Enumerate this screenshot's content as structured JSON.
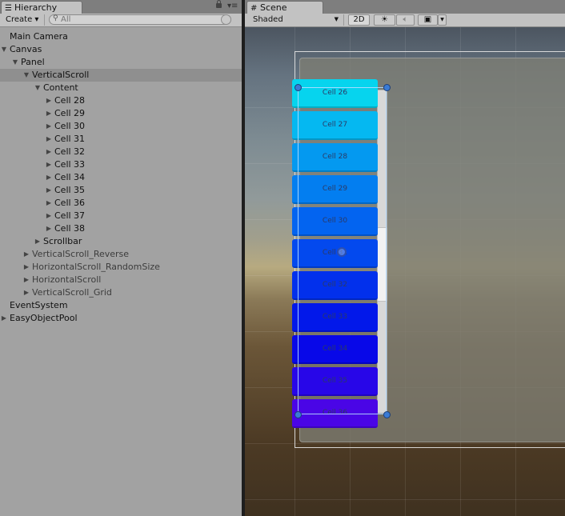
{
  "hierarchy": {
    "tab_label": "Hierarchy",
    "tab_icon": "list-icon",
    "create_label": "Create ▾",
    "search_placeholder": "All",
    "items": [
      {
        "label": "Main Camera",
        "depth": 0,
        "arrow": "",
        "selected": false,
        "dim": false
      },
      {
        "label": "Canvas",
        "depth": 0,
        "arrow": "▼",
        "selected": false,
        "dim": false
      },
      {
        "label": "Panel",
        "depth": 1,
        "arrow": "▼",
        "selected": false,
        "dim": false
      },
      {
        "label": "VerticalScroll",
        "depth": 2,
        "arrow": "▼",
        "selected": true,
        "dim": false
      },
      {
        "label": "Content",
        "depth": 3,
        "arrow": "▼",
        "selected": false,
        "dim": false
      },
      {
        "label": "Cell 28",
        "depth": 4,
        "arrow": "▶",
        "selected": false,
        "dim": false
      },
      {
        "label": "Cell 29",
        "depth": 4,
        "arrow": "▶",
        "selected": false,
        "dim": false
      },
      {
        "label": "Cell 30",
        "depth": 4,
        "arrow": "▶",
        "selected": false,
        "dim": false
      },
      {
        "label": "Cell 31",
        "depth": 4,
        "arrow": "▶",
        "selected": false,
        "dim": false
      },
      {
        "label": "Cell 32",
        "depth": 4,
        "arrow": "▶",
        "selected": false,
        "dim": false
      },
      {
        "label": "Cell 33",
        "depth": 4,
        "arrow": "▶",
        "selected": false,
        "dim": false
      },
      {
        "label": "Cell 34",
        "depth": 4,
        "arrow": "▶",
        "selected": false,
        "dim": false
      },
      {
        "label": "Cell 35",
        "depth": 4,
        "arrow": "▶",
        "selected": false,
        "dim": false
      },
      {
        "label": "Cell 36",
        "depth": 4,
        "arrow": "▶",
        "selected": false,
        "dim": false
      },
      {
        "label": "Cell 37",
        "depth": 4,
        "arrow": "▶",
        "selected": false,
        "dim": false
      },
      {
        "label": "Cell 38",
        "depth": 4,
        "arrow": "▶",
        "selected": false,
        "dim": false
      },
      {
        "label": "Scrollbar",
        "depth": 3,
        "arrow": "▶",
        "selected": false,
        "dim": false
      },
      {
        "label": "VerticalScroll_Reverse",
        "depth": 2,
        "arrow": "▶",
        "selected": false,
        "dim": true
      },
      {
        "label": "HorizontalScroll_RandomSize",
        "depth": 2,
        "arrow": "▶",
        "selected": false,
        "dim": true
      },
      {
        "label": "HorizontalScroll",
        "depth": 2,
        "arrow": "▶",
        "selected": false,
        "dim": true
      },
      {
        "label": "VerticalScroll_Grid",
        "depth": 2,
        "arrow": "▶",
        "selected": false,
        "dim": true
      },
      {
        "label": "EventSystem",
        "depth": 0,
        "arrow": "",
        "selected": false,
        "dim": false
      },
      {
        "label": "EasyObjectPool",
        "depth": 0,
        "arrow": "▶",
        "selected": false,
        "dim": false
      }
    ]
  },
  "scene": {
    "tab_label": "Scene",
    "tab_icon": "grid-icon",
    "shading_mode": "Shaded",
    "mode_2d_label": "2D",
    "light_icon": "sun-icon",
    "audio_icon": "speaker-icon",
    "effects_icon": "image-icon",
    "cells": [
      {
        "label": "Cell 26",
        "color": "#06d4ee"
      },
      {
        "label": "Cell 27",
        "color": "#05b8f1"
      },
      {
        "label": "Cell 28",
        "color": "#0499f0"
      },
      {
        "label": "Cell 29",
        "color": "#037ef0"
      },
      {
        "label": "Cell 30",
        "color": "#0364f0"
      },
      {
        "label": "Cell 31",
        "color": "#0349ee"
      },
      {
        "label": "Cell 32",
        "color": "#0230ec"
      },
      {
        "label": "Cell 33",
        "color": "#0218ea"
      },
      {
        "label": "Cell 34",
        "color": "#0808e8"
      },
      {
        "label": "Cell 35",
        "color": "#2806e8"
      },
      {
        "label": "Cell 36",
        "color": "#4a05e6"
      }
    ],
    "scrollbar_position": 0.55
  }
}
